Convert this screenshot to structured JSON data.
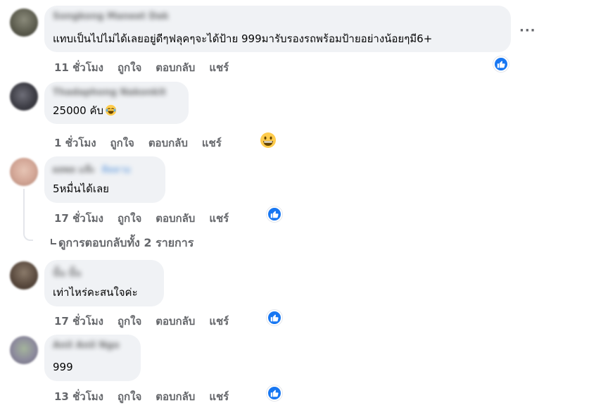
{
  "comments": [
    {
      "author": "Songkong Maneet Dak",
      "text": "แทบเป็นไปไม่ได้เลยอยู่ดีๆฟลุคๆจะได้ป้าย 999มารับรองรถพร้อมป้ายอย่างน้อยๆมี6+",
      "time": "11 ชั่วโมง",
      "like": "ถูกใจ",
      "reply": "ตอบกลับ",
      "share": "แชร์",
      "reaction": "like-icon"
    },
    {
      "author": "Thadaphong Nakonkit",
      "text": "25000 คับ",
      "time": "1 ชั่วโมง",
      "like": "ถูกใจ",
      "reply": "ตอบกลับ",
      "share": "แชร์",
      "reaction": "grinning-face-icon"
    },
    {
      "author": "ผลพล แจ๊ะ",
      "author_tag": "ติดตาม",
      "text": "5หมื่นได้เลย",
      "time": "17 ชั่วโมง",
      "like": "ถูกใจ",
      "reply": "ตอบกลับ",
      "share": "แชร์",
      "reaction": "like-icon"
    },
    {
      "author": "นั้น นั้น",
      "text": "เท่าไหร่คะสนใจค่ะ",
      "time": "17 ชั่วโมง",
      "like": "ถูกใจ",
      "reply": "ตอบกลับ",
      "share": "แชร์",
      "reaction": "like-icon"
    },
    {
      "author": "Anil Anil Ngo",
      "text": "999",
      "time": "13 ชั่วโมง",
      "like": "ถูกใจ",
      "reply": "ตอบกลับ",
      "share": "แชร์",
      "reaction": "like-icon"
    }
  ],
  "view_replies": "ดูการตอบกลับทั้ง 2 รายการ",
  "more_label": "···",
  "colors": {
    "bubble": "#f0f2f5",
    "secondary_text": "#65676b",
    "like_blue": "#1877f2",
    "emoji_yellow": "#ffcc4d"
  }
}
